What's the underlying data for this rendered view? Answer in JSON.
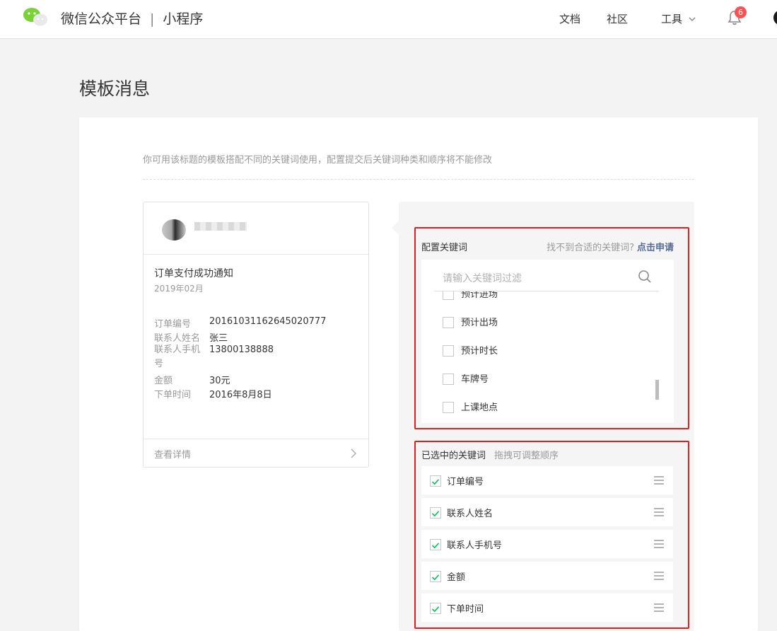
{
  "header": {
    "brand": "微信公众平台",
    "separator": "|",
    "product": "小程序",
    "nav": {
      "docs": "文档",
      "community": "社区",
      "tools": "工具"
    },
    "notification_count": "6"
  },
  "page": {
    "title": "模板消息",
    "hint": "你可用该标题的模板搭配不同的关键词使用，配置提交后关键词种类和顺序将不能修改"
  },
  "preview": {
    "template_title": "订单支付成功通知",
    "date": "2019年02月",
    "rows": [
      {
        "key": "订单编号",
        "value": "20161031162645020777"
      },
      {
        "key": "联系人姓名",
        "value": "张三"
      },
      {
        "key": "联系人手机号",
        "value": "13800138888"
      },
      {
        "key": "金额",
        "value": "30元"
      },
      {
        "key": "下单时间",
        "value": "2016年8月8日"
      }
    ],
    "footer": "查看详情"
  },
  "config": {
    "title": "配置关键词",
    "missing_prompt": "找不到合适的关键词?",
    "apply_link": "点击申请",
    "search_placeholder": "请输入关键词过滤",
    "keywords": [
      "预计进场",
      "预计出场",
      "预计时长",
      "车牌号",
      "上课地点"
    ]
  },
  "selected": {
    "title": "已选中的关键词",
    "hint": "拖拽可调整顺序",
    "items": [
      "订单编号",
      "联系人姓名",
      "联系人手机号",
      "金额",
      "下单时间"
    ]
  },
  "colors": {
    "brand_green": "#07c160",
    "highlight_red": "#e0201e",
    "link_blue": "#576b95",
    "badge_red": "#fa5151"
  }
}
